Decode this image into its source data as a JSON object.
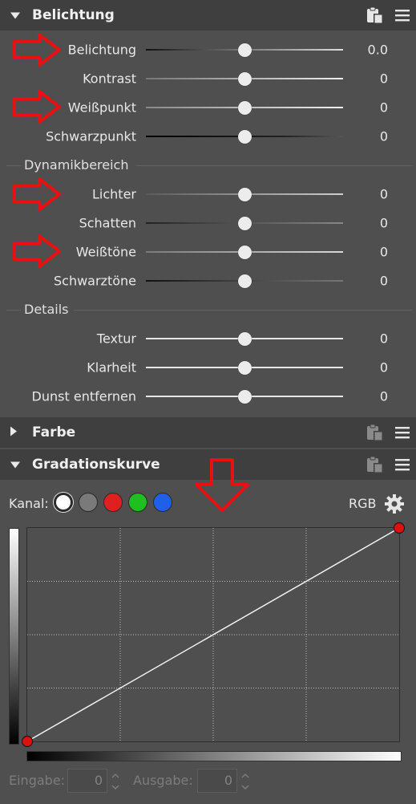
{
  "exposure_panel": {
    "title": "Belichtung",
    "rows": [
      {
        "label": "Belichtung",
        "value": "0.0",
        "position": 0.5
      },
      {
        "label": "Kontrast",
        "value": "0",
        "position": 0.5
      },
      {
        "label": "Weißpunkt",
        "value": "0",
        "position": 0.5
      },
      {
        "label": "Schwarzpunkt",
        "value": "0",
        "position": 0.5
      }
    ],
    "dynamic_section": {
      "title": "Dynamikbereich",
      "rows": [
        {
          "label": "Lichter",
          "value": "0",
          "position": 0.5
        },
        {
          "label": "Schatten",
          "value": "0",
          "position": 0.5
        },
        {
          "label": "Weißtöne",
          "value": "0",
          "position": 0.5
        },
        {
          "label": "Schwarztöne",
          "value": "0",
          "position": 0.5
        }
      ]
    },
    "details_section": {
      "title": "Details",
      "rows": [
        {
          "label": "Textur",
          "value": "0",
          "position": 0.5
        },
        {
          "label": "Klarheit",
          "value": "0",
          "position": 0.5
        },
        {
          "label": "Dunst entfernen",
          "value": "0",
          "position": 0.5
        }
      ]
    }
  },
  "color_panel": {
    "title": "Farbe"
  },
  "curve_panel": {
    "title": "Gradationskurve",
    "channel_label": "Kanal:",
    "channels": [
      {
        "name": "white",
        "color": "#ffffff",
        "selected": true
      },
      {
        "name": "gray",
        "color": "#7a7a7a",
        "selected": false
      },
      {
        "name": "red",
        "color": "#e02020",
        "selected": false
      },
      {
        "name": "green",
        "color": "#1fbf1f",
        "selected": false
      },
      {
        "name": "blue",
        "color": "#2060e8",
        "selected": false
      }
    ],
    "mode_label": "RGB",
    "curve_points": [
      {
        "input": 0,
        "output": 0
      },
      {
        "input": 1,
        "output": 1
      }
    ],
    "point_color": "#e01010",
    "input_label": "Eingabe:",
    "input_value": "0",
    "output_label": "Ausgabe:",
    "output_value": "0"
  },
  "annotation_color": "#e81010",
  "icons": [
    "collapse-triangle-icon",
    "expand-triangle-icon",
    "paste-settings-icon",
    "menu-icon",
    "gear-icon",
    "red-arrow-icon"
  ]
}
